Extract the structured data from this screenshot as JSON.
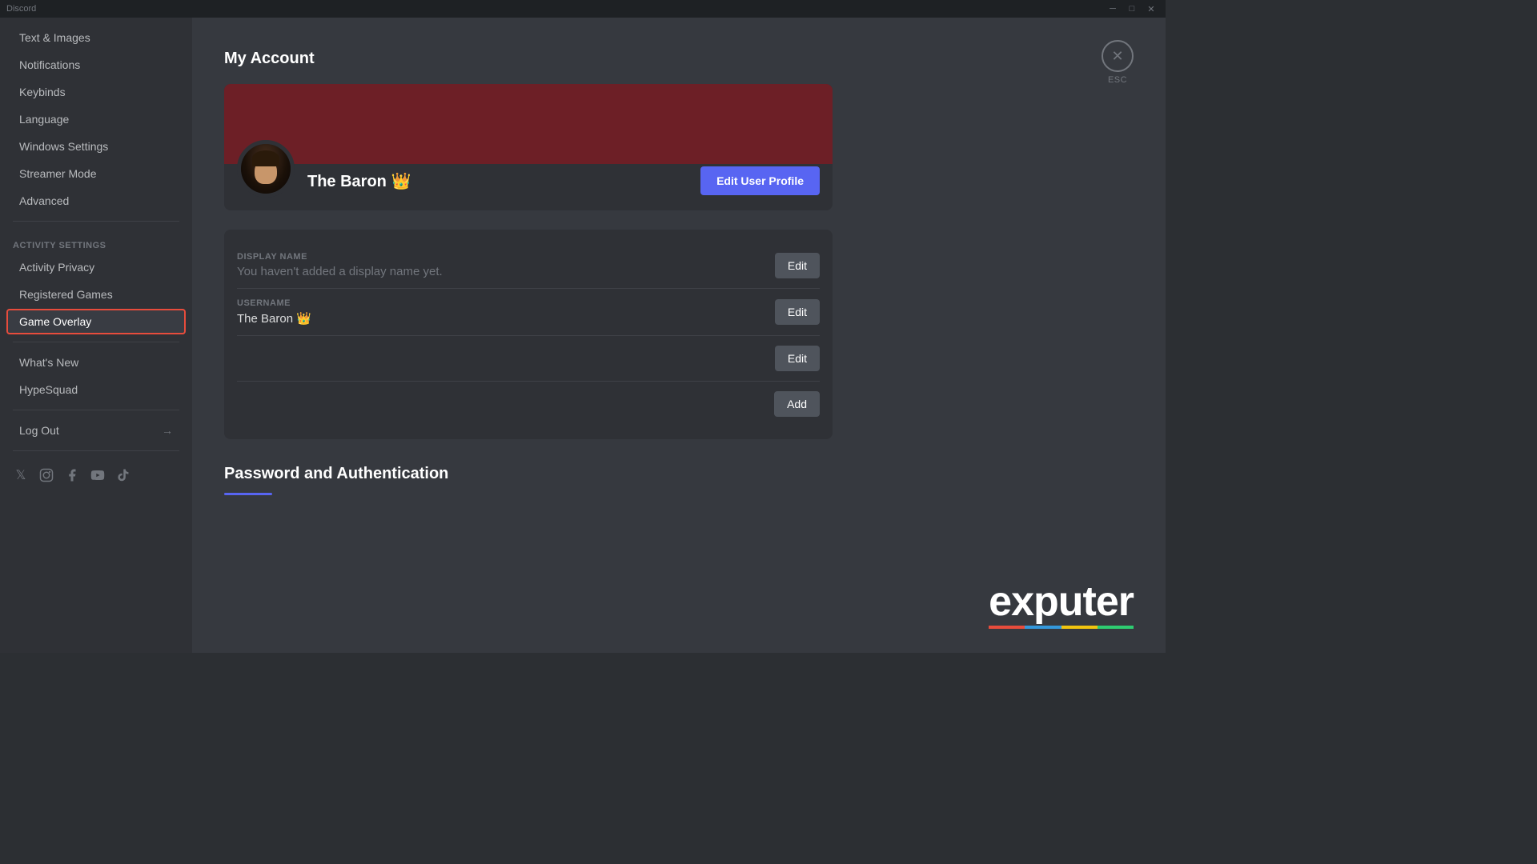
{
  "titlebar": {
    "title": "Discord",
    "minimize": "─",
    "maximize": "□",
    "close": "✕"
  },
  "sidebar": {
    "top_items": [
      {
        "id": "text-images",
        "label": "Text & Images"
      },
      {
        "id": "notifications",
        "label": "Notifications"
      },
      {
        "id": "keybinds",
        "label": "Keybinds"
      },
      {
        "id": "language",
        "label": "Language"
      },
      {
        "id": "windows-settings",
        "label": "Windows Settings"
      },
      {
        "id": "streamer-mode",
        "label": "Streamer Mode"
      },
      {
        "id": "advanced",
        "label": "Advanced"
      }
    ],
    "activity_section_label": "Activity Settings",
    "activity_items": [
      {
        "id": "activity-privacy",
        "label": "Activity Privacy"
      },
      {
        "id": "registered-games",
        "label": "Registered Games"
      },
      {
        "id": "game-overlay",
        "label": "Game Overlay",
        "active": true
      }
    ],
    "misc_items": [
      {
        "id": "whats-new",
        "label": "What's New"
      },
      {
        "id": "hypesquad",
        "label": "HypeSquad"
      }
    ],
    "logout_label": "Log Out",
    "logout_icon": "→"
  },
  "main": {
    "page_title": "My Account",
    "esc_label": "ESC",
    "profile": {
      "username": "The Baron 👑",
      "username_detail": "The Baron 👑",
      "edit_button": "Edit User Profile"
    },
    "fields": [
      {
        "label": "DISPLAY NAME",
        "value": "You haven't added a display name yet.",
        "is_placeholder": true,
        "button_label": "Edit",
        "button_type": "edit"
      },
      {
        "label": "USERNAME",
        "value": "The Baron 👑",
        "is_placeholder": false,
        "button_label": "Edit",
        "button_type": "edit"
      },
      {
        "label": "",
        "value": "",
        "is_placeholder": false,
        "button_label": "Edit",
        "button_type": "edit"
      },
      {
        "label": "",
        "value": "",
        "is_placeholder": false,
        "button_label": "Add",
        "button_type": "add"
      }
    ],
    "password_section_title": "Password and Authentication"
  },
  "watermark": {
    "text": "exputer",
    "colors": [
      "#e74c3c",
      "#3498db",
      "#f1c40f",
      "#2ecc71"
    ]
  }
}
